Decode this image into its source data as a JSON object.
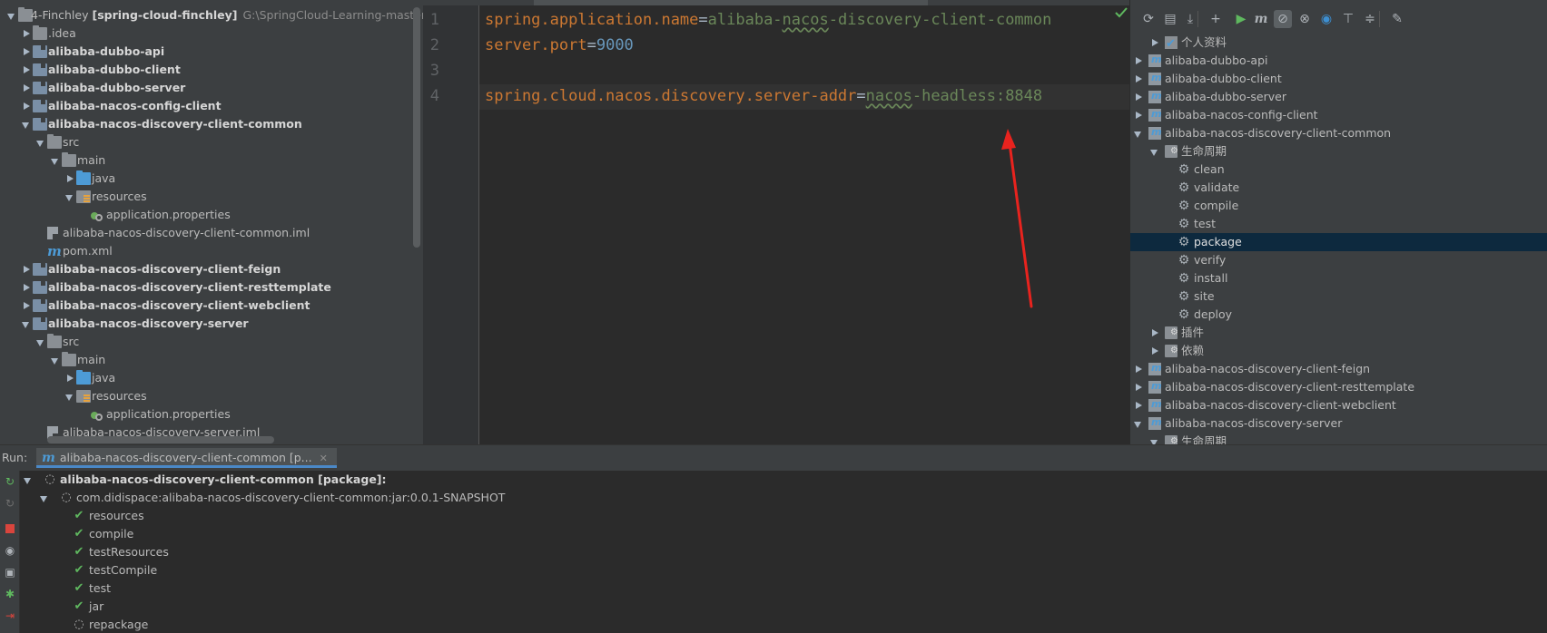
{
  "project": {
    "root_name": "4-Finchley",
    "root_module": "[spring-cloud-finchley]",
    "root_path": "G:\\SpringCloud-Learning-master\\Spri",
    "items": [
      {
        "label": "alibaba-dubbo-api",
        "icon": "module-icon"
      },
      {
        "label": "alibaba-dubbo-client",
        "icon": "module-icon"
      },
      {
        "label": "alibaba-dubbo-server",
        "icon": "module-icon"
      },
      {
        "label": "alibaba-nacos-config-client",
        "icon": "module-icon"
      },
      {
        "label": "alibaba-nacos-discovery-client-common",
        "icon": "module-icon"
      },
      {
        "label": "src",
        "icon": "folder-icon"
      },
      {
        "label": "main",
        "icon": "folder-icon"
      },
      {
        "label": "java",
        "icon": "source-folder-icon"
      },
      {
        "label": "resources",
        "icon": "resources-folder-icon"
      },
      {
        "label": "application.properties",
        "icon": "properties-file-icon"
      },
      {
        "label": "alibaba-nacos-discovery-client-common.iml",
        "icon": "iml-file-icon"
      },
      {
        "label": "pom.xml",
        "icon": "maven-pom-icon"
      },
      {
        "label": "alibaba-nacos-discovery-client-feign",
        "icon": "module-icon"
      },
      {
        "label": "alibaba-nacos-discovery-client-resttemplate",
        "icon": "module-icon"
      },
      {
        "label": "alibaba-nacos-discovery-client-webclient",
        "icon": "module-icon"
      },
      {
        "label": "alibaba-nacos-discovery-server",
        "icon": "module-icon"
      },
      {
        "label": "src",
        "icon": "folder-icon"
      },
      {
        "label": "main",
        "icon": "folder-icon"
      },
      {
        "label": "java",
        "icon": "source-folder-icon"
      },
      {
        "label": "resources",
        "icon": "resources-folder-icon"
      },
      {
        "label": "application.properties",
        "icon": "properties-file-icon"
      },
      {
        "label": "alibaba-nacos-discovery-server.iml",
        "icon": "iml-file-icon"
      }
    ],
    "idea_label": ".idea"
  },
  "editor": {
    "line_numbers": [
      "1",
      "2",
      "3",
      "4"
    ],
    "line1": {
      "key": "spring.application.name",
      "eq": "=",
      "val_a": "alibaba-",
      "val_typo": "nacos",
      "val_b": "-discovery-client-common"
    },
    "line2": {
      "key": "server.port",
      "eq": "=",
      "val": "9000"
    },
    "line4": {
      "key": "spring.cloud.nacos.discovery.server-addr",
      "eq": "=",
      "val_typo": "nacos",
      "val_b": "-headless:8848"
    },
    "annotation_color": "#e8231e"
  },
  "maven": {
    "toolbar": [
      "reload-icon",
      "add-folder-icon",
      "download-icon",
      "plus-icon",
      "run-icon",
      "maven-goal-icon",
      "toggle-offline-icon",
      "skip-tests-icon",
      "show-dependencies-icon",
      "collapse-icon",
      "expand-icon",
      "settings-wrench-icon"
    ],
    "profiles": "个人资料",
    "modules_top": [
      "alibaba-dubbo-api",
      "alibaba-dubbo-client",
      "alibaba-dubbo-server",
      "alibaba-nacos-config-client"
    ],
    "expanded_module": "alibaba-nacos-discovery-client-common",
    "lifecycle": "生命周期",
    "phases": [
      "clean",
      "validate",
      "compile",
      "test",
      "package",
      "verify",
      "install",
      "site",
      "deploy"
    ],
    "selected_phase": "package",
    "plugins": "插件",
    "dependencies": "依赖",
    "modules_bottom": [
      "alibaba-nacos-discovery-client-feign",
      "alibaba-nacos-discovery-client-resttemplate",
      "alibaba-nacos-discovery-client-webclient",
      "alibaba-nacos-discovery-server"
    ],
    "lifecycle_2": "生命周期"
  },
  "run": {
    "title": "Run:",
    "tab_label": "alibaba-nacos-discovery-client-common [p...",
    "tab_close": "✕",
    "root": "alibaba-nacos-discovery-client-common [package]:",
    "artifact": "com.didispace:alibaba-nacos-discovery-client-common:jar:0.0.1-SNAPSHOT",
    "steps": [
      {
        "label": "resources",
        "status": "done"
      },
      {
        "label": "compile",
        "status": "done"
      },
      {
        "label": "testResources",
        "status": "done"
      },
      {
        "label": "testCompile",
        "status": "done"
      },
      {
        "label": "test",
        "status": "done"
      },
      {
        "label": "jar",
        "status": "done"
      },
      {
        "label": "repackage",
        "status": "running"
      }
    ]
  }
}
